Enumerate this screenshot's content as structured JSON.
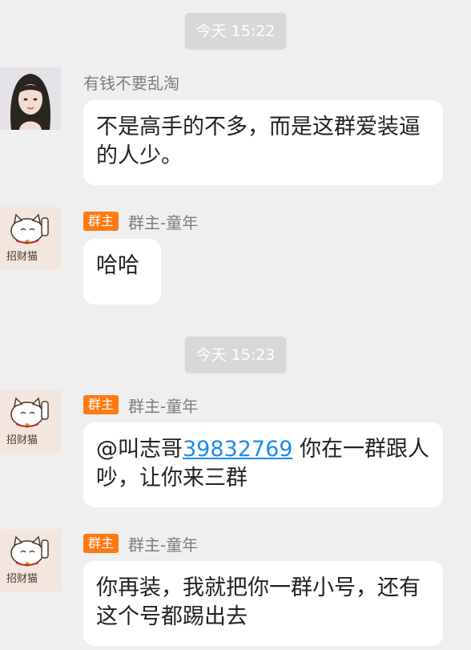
{
  "timestamps": [
    "今天 15:22",
    "今天 15:23"
  ],
  "messages": [
    {
      "sender": "有钱不要乱淘",
      "role": "",
      "text": "不是高手的不多，而是这群爱装逼的人少。"
    },
    {
      "sender": "群主-童年",
      "role": "群主",
      "text": "哈哈"
    },
    {
      "sender": "群主-童年",
      "role": "群主",
      "mention": "@叫志哥",
      "link": "39832769",
      "text": " 你在一群跟人吵，让你来三群"
    },
    {
      "sender": "群主-童年",
      "role": "群主",
      "text": "你再装，我就把你一群小号，还有这个号都踢出去"
    }
  ],
  "avatar_caption": "招财猫"
}
